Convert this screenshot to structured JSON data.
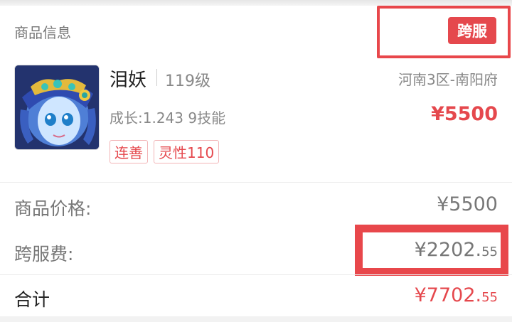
{
  "section": {
    "title": "商品信息"
  },
  "tag": {
    "label": "跨服"
  },
  "item": {
    "avatar_icon": "pet-avatar-icon",
    "name": "泪妖",
    "level": "119级",
    "server": "河南3区-南阳府",
    "growth": "成长:1.243 9技能",
    "price": "¥5500",
    "badges": [
      "连善",
      "灵性110"
    ]
  },
  "summary": {
    "goods_price_label": "商品价格:",
    "goods_price_value": "¥5500",
    "cross_fee_label": "跨服费:",
    "cross_fee_main": "¥2202.",
    "cross_fee_cents": "55",
    "total_label": "合计",
    "total_main": "¥7702.",
    "total_cents": "55"
  },
  "colors": {
    "accent": "#e5484d",
    "highlight_box": "#e8474b",
    "muted_text": "#888888"
  }
}
